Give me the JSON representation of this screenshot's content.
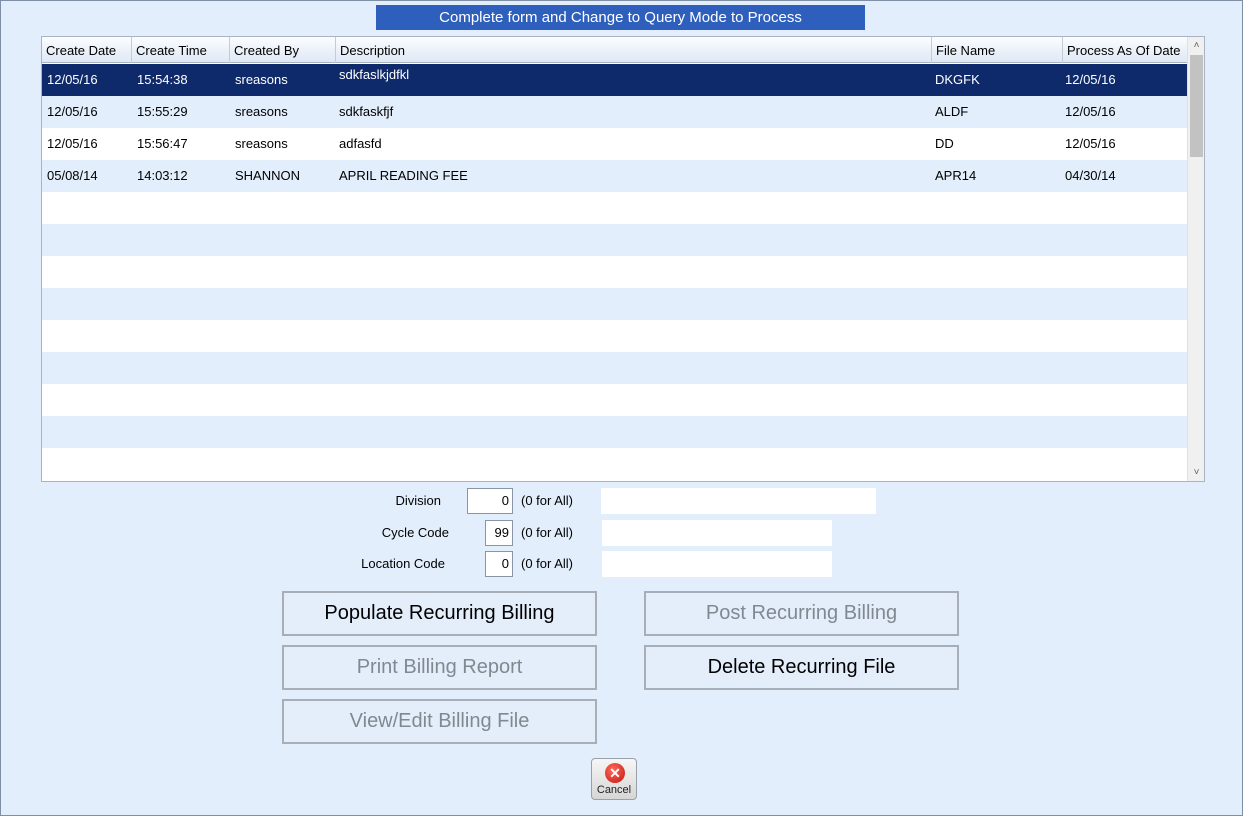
{
  "banner": "Complete form and Change to Query Mode to Process",
  "grid": {
    "columns": [
      "Create Date",
      "Create Time",
      "Created By",
      "Description",
      "File Name",
      "Process As Of Date"
    ],
    "rows": [
      {
        "date": "12/05/16",
        "time": "15:54:38",
        "by": "sreasons",
        "desc": "sdkfaslkjdfkl",
        "file": "DKGFK",
        "asof": "12/05/16"
      },
      {
        "date": "12/05/16",
        "time": "15:55:29",
        "by": "sreasons",
        "desc": "sdkfaskfjf",
        "file": "ALDF",
        "asof": "12/05/16"
      },
      {
        "date": "12/05/16",
        "time": "15:56:47",
        "by": "sreasons",
        "desc": "adfasfd",
        "file": "DD",
        "asof": "12/05/16"
      },
      {
        "date": "05/08/14",
        "time": "14:03:12",
        "by": "SHANNON",
        "desc": "APRIL READING FEE",
        "file": "APR14",
        "asof": "04/30/14"
      }
    ],
    "selected_row": 1
  },
  "filters": {
    "division": {
      "label": "Division",
      "value": "0",
      "hint": "(0 for All)"
    },
    "cycle_code": {
      "label": "Cycle Code",
      "value": "99",
      "hint": "(0 for All)"
    },
    "location_code": {
      "label": "Location Code",
      "value": "0",
      "hint": "(0 for All)"
    }
  },
  "buttons": {
    "populate": "Populate Recurring Billing",
    "post": "Post Recurring Billing",
    "print": "Print Billing Report",
    "delete": "Delete Recurring File",
    "view_edit": "View/Edit Billing File",
    "cancel": "Cancel"
  },
  "icons": {
    "cancel": "cancel-x-icon",
    "scroll_up": "chevron-up-icon",
    "scroll_down": "chevron-down-icon"
  }
}
